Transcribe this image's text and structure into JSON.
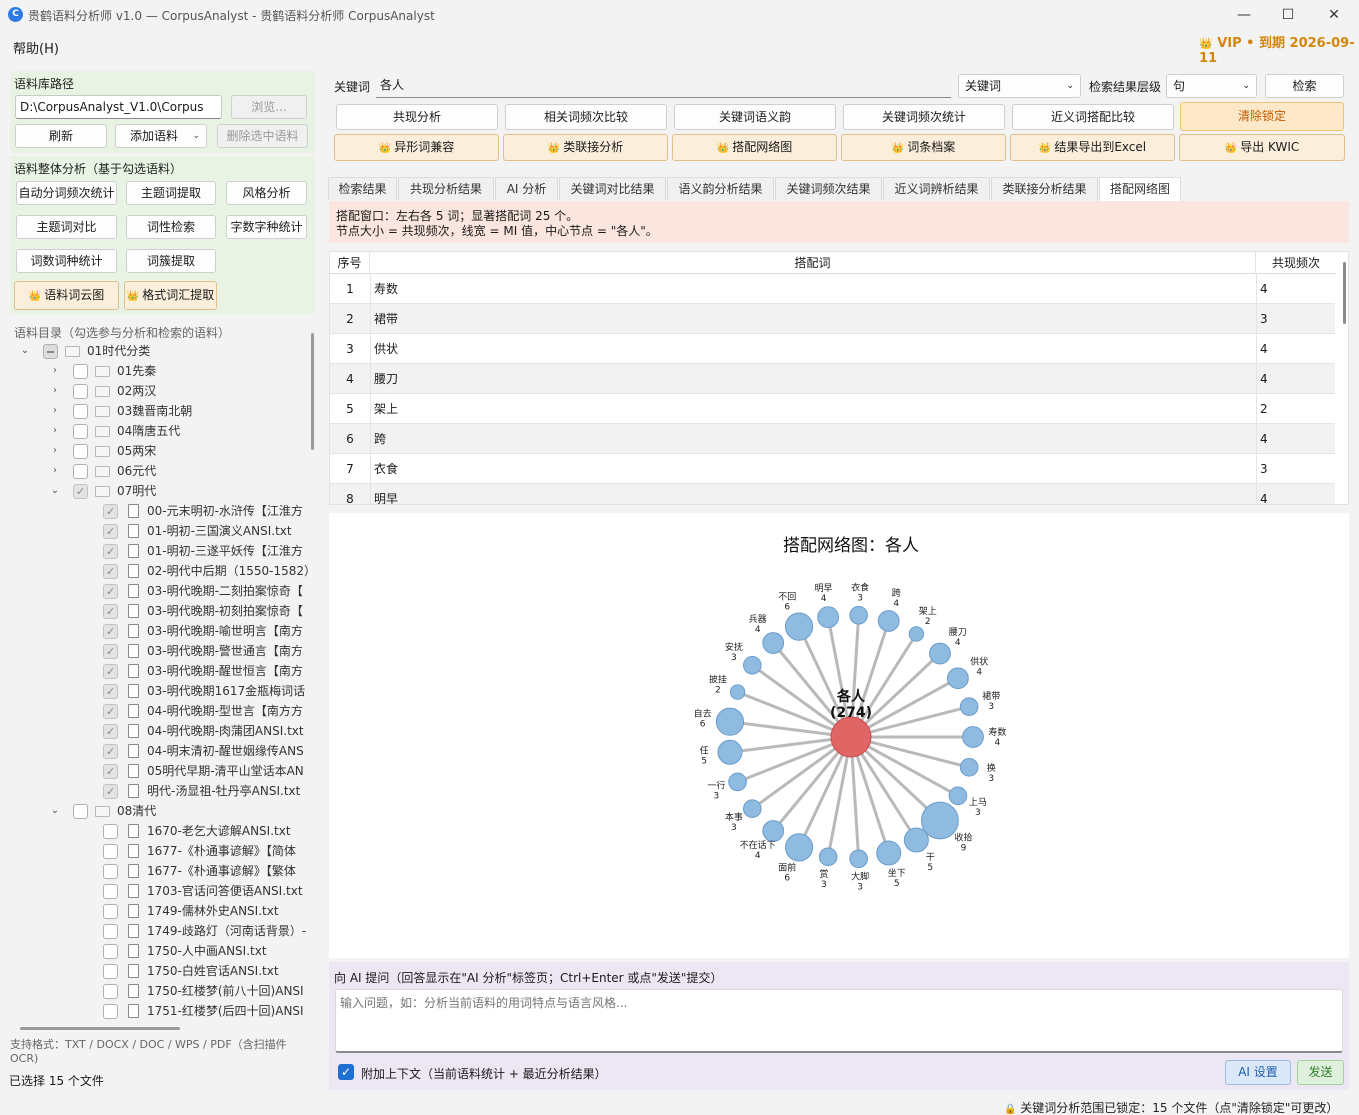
{
  "window": {
    "title": "贵鹤语料分析师 v1.0 — CorpusAnalyst - 贵鹤语料分析师 CorpusAnalyst",
    "app_icon_letter": "C",
    "controls": {
      "minimize": "—",
      "maximize": "☐",
      "close": "✕"
    }
  },
  "menu": {
    "help": "帮助(H)"
  },
  "vip": {
    "crown": "👑",
    "text": "VIP • 到期 2026-09-11"
  },
  "corpus_path": {
    "title": "语料库路径",
    "path_value": "D:\\CorpusAnalyst_V1.0\\Corpus",
    "browse": "浏览...",
    "refresh": "刷新",
    "add_corpus": "添加语料",
    "delete_selected": "删除选中语料"
  },
  "overall_analysis": {
    "title": "语料整体分析（基于勾选语料）",
    "buttons": [
      "自动分词频次统计",
      "主题词提取",
      "风格分析",
      "主题词对比",
      "词性检索",
      "字数字种统计",
      "词数词种统计",
      "词簇提取"
    ],
    "vip_buttons": [
      "语料词云图",
      "格式词汇提取"
    ]
  },
  "catalog": {
    "title": "语料目录（勾选参与分析和检索的语料）",
    "rows": [
      {
        "level": 0,
        "type": "folder",
        "expanded": true,
        "state": "partial",
        "label": "01时代分类"
      },
      {
        "level": 1,
        "type": "folder",
        "expanded": false,
        "state": "none",
        "label": "01先秦"
      },
      {
        "level": 1,
        "type": "folder",
        "expanded": false,
        "state": "none",
        "label": "02两汉"
      },
      {
        "level": 1,
        "type": "folder",
        "expanded": false,
        "state": "none",
        "label": "03魏晋南北朝"
      },
      {
        "level": 1,
        "type": "folder",
        "expanded": false,
        "state": "none",
        "label": "04隋唐五代"
      },
      {
        "level": 1,
        "type": "folder",
        "expanded": false,
        "state": "none",
        "label": "05两宋"
      },
      {
        "level": 1,
        "type": "folder",
        "expanded": false,
        "state": "none",
        "label": "06元代"
      },
      {
        "level": 1,
        "type": "folder",
        "expanded": true,
        "state": "checked",
        "label": "07明代"
      },
      {
        "level": 2,
        "type": "file",
        "state": "checked",
        "label": "00-元末明初-水浒传【江淮方"
      },
      {
        "level": 2,
        "type": "file",
        "state": "checked",
        "label": "01-明初-三国演义ANSI.txt"
      },
      {
        "level": 2,
        "type": "file",
        "state": "checked",
        "label": "01-明初-三遂平妖传【江淮方"
      },
      {
        "level": 2,
        "type": "file",
        "state": "checked",
        "label": "02-明代中后期（1550-1582）"
      },
      {
        "level": 2,
        "type": "file",
        "state": "checked",
        "label": "03-明代晚期-二刻拍案惊奇【"
      },
      {
        "level": 2,
        "type": "file",
        "state": "checked",
        "label": "03-明代晚期-初刻拍案惊奇【"
      },
      {
        "level": 2,
        "type": "file",
        "state": "checked",
        "label": "03-明代晚期-喻世明言【南方"
      },
      {
        "level": 2,
        "type": "file",
        "state": "checked",
        "label": "03-明代晚期-警世通言【南方"
      },
      {
        "level": 2,
        "type": "file",
        "state": "checked",
        "label": "03-明代晚期-醒世恒言【南方"
      },
      {
        "level": 2,
        "type": "file",
        "state": "checked",
        "label": "03-明代晚期1617金瓶梅词话"
      },
      {
        "level": 2,
        "type": "file",
        "state": "checked",
        "label": "04-明代晚期-型世言【南方方"
      },
      {
        "level": 2,
        "type": "file",
        "state": "checked",
        "label": "04-明代晚期-肉蒲团ANSI.txt"
      },
      {
        "level": 2,
        "type": "file",
        "state": "checked",
        "label": "04-明末清初-醒世姻缘传ANS"
      },
      {
        "level": 2,
        "type": "file",
        "state": "checked",
        "label": "05明代早期-清平山堂话本AN"
      },
      {
        "level": 2,
        "type": "file",
        "state": "checked",
        "label": "明代-汤显祖-牡丹亭ANSI.txt"
      },
      {
        "level": 1,
        "type": "folder",
        "expanded": true,
        "state": "none",
        "label": "08清代"
      },
      {
        "level": 2,
        "type": "file",
        "state": "none",
        "label": "1670-老乞大谚解ANSI.txt"
      },
      {
        "level": 2,
        "type": "file",
        "state": "none",
        "label": "1677-《朴通事谚解》【简体"
      },
      {
        "level": 2,
        "type": "file",
        "state": "none",
        "label": "1677-《朴通事谚解》【繁体"
      },
      {
        "level": 2,
        "type": "file",
        "state": "none",
        "label": "1703-官话问答便语ANSI.txt"
      },
      {
        "level": 2,
        "type": "file",
        "state": "none",
        "label": "1749-儒林外史ANSI.txt"
      },
      {
        "level": 2,
        "type": "file",
        "state": "none",
        "label": "1749-歧路灯（河南话背景）-"
      },
      {
        "level": 2,
        "type": "file",
        "state": "none",
        "label": "1750-人中画ANSI.txt"
      },
      {
        "level": 2,
        "type": "file",
        "state": "none",
        "label": "1750-白姓官话ANSI.txt"
      },
      {
        "level": 2,
        "type": "file",
        "state": "none",
        "label": "1750-红楼梦(前八十回)ANSI"
      },
      {
        "level": 2,
        "type": "file",
        "state": "none",
        "label": "1751-红楼梦(后四十回)ANSI"
      }
    ],
    "supported_formats": "支持格式：TXT / DOCX / DOC / WPS / PDF（含扫描件 OCR)",
    "selected_count": "已选择 15 个文件"
  },
  "search": {
    "keyword_label": "关键词",
    "keyword_value": "各人",
    "mode_value": "关键词",
    "level_label": "检索结果层级",
    "level_value": "句",
    "search_button": "检索"
  },
  "function_buttons": {
    "row1": [
      "共现分析",
      "相关词频次比较",
      "关键词语义韵",
      "关键词频次统计",
      "近义词搭配比较"
    ],
    "clear_lock": "清除锁定",
    "row2_vip": [
      "异形词兼容",
      "类联接分析",
      "搭配网络图",
      "词条档案",
      "结果导出到Excel",
      "导出 KWIC"
    ]
  },
  "tabs": [
    "检索结果",
    "共现分析结果",
    "AI 分析",
    "关键词对比结果",
    "语义韵分析结果",
    "关键词频次结果",
    "近义词辨析结果",
    "类联接分析结果",
    "搭配网络图"
  ],
  "active_tab": "搭配网络图",
  "info": {
    "line1": "搭配窗口：左右各 5 词；显著搭配词 25 个。",
    "line2": "节点大小 = 共现频次，线宽 = MI 值，中心节点 = \"各人\"。"
  },
  "table": {
    "headers": [
      "序号",
      "搭配词",
      "共现频次"
    ],
    "rows": [
      [
        "1",
        "寿数",
        "4"
      ],
      [
        "2",
        "裙带",
        "3"
      ],
      [
        "3",
        "供状",
        "4"
      ],
      [
        "4",
        "腰刀",
        "4"
      ],
      [
        "5",
        "架上",
        "2"
      ],
      [
        "6",
        "跨",
        "4"
      ],
      [
        "7",
        "衣食",
        "3"
      ],
      [
        "8",
        "明早",
        "4"
      ]
    ]
  },
  "graph": {
    "title": "搭配网络图：各人",
    "center_label": "各人",
    "center_count": "(274)",
    "center_color": "#e06666",
    "node_color": "#8fbbe0",
    "nodes": [
      {
        "word": "寿数",
        "freq": 4
      },
      {
        "word": "裙带",
        "freq": 3
      },
      {
        "word": "供状",
        "freq": 4
      },
      {
        "word": "腰刀",
        "freq": 4
      },
      {
        "word": "架上",
        "freq": 2
      },
      {
        "word": "跨",
        "freq": 4
      },
      {
        "word": "衣食",
        "freq": 3
      },
      {
        "word": "明早",
        "freq": 4
      },
      {
        "word": "不回",
        "freq": 6
      },
      {
        "word": "兵器",
        "freq": 4
      },
      {
        "word": "安抚",
        "freq": 3
      },
      {
        "word": "披挂",
        "freq": 2
      },
      {
        "word": "自去",
        "freq": 6
      },
      {
        "word": "任",
        "freq": 5
      },
      {
        "word": "一行",
        "freq": 3
      },
      {
        "word": "本事",
        "freq": 3
      },
      {
        "word": "不在话下",
        "freq": 4
      },
      {
        "word": "面前",
        "freq": 6
      },
      {
        "word": "赏",
        "freq": 3
      },
      {
        "word": "大脚",
        "freq": 3
      },
      {
        "word": "坐下",
        "freq": 5
      },
      {
        "word": "干",
        "freq": 5
      },
      {
        "word": "收拾",
        "freq": 9
      },
      {
        "word": "上马",
        "freq": 3
      },
      {
        "word": "换",
        "freq": 3
      }
    ]
  },
  "ai": {
    "title": "向 AI 提问（回答显示在\"AI 分析\"标签页；Ctrl+Enter 或点\"发送\"提交）",
    "placeholder": "输入问题，如：分析当前语料的用词特点与语言风格...",
    "attach_context": "附加上下文（当前语料统计 + 最近分析结果）",
    "settings": "AI 设置",
    "send": "发送"
  },
  "status": {
    "lock_icon": "🔒",
    "text": "关键词分析范围已锁定：15 个文件（点\"清除锁定\"可更改）"
  }
}
